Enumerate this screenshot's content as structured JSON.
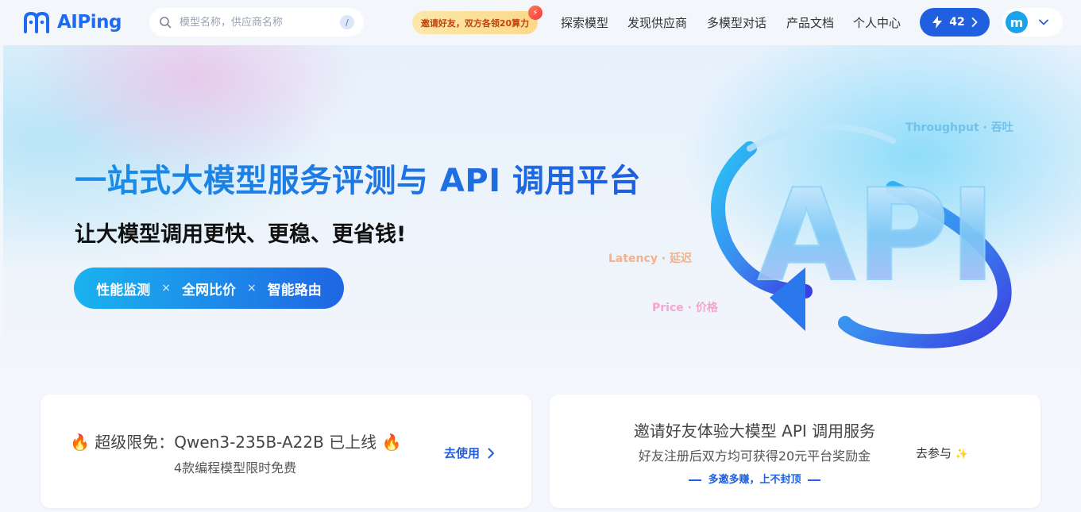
{
  "header": {
    "logo_text": "AIPing",
    "search": {
      "placeholder": "模型名称，供应商名称",
      "shortcut": "/"
    },
    "invite_promo": "邀请好友，双方各领20算力",
    "nav": [
      "探索模型",
      "发现供应商",
      "多模型对话",
      "产品文档",
      "个人中心"
    ],
    "credits": "42",
    "avatar_letter": "m"
  },
  "hero": {
    "title": "一站式大模型服务评测与 API 调用平台",
    "subtitle": "让大模型调用更快、更稳、更省钱!",
    "features": [
      "性能监测",
      "全网比价",
      "智能路由"
    ],
    "feature_separator": "×",
    "art_text": "API",
    "labels": {
      "throughput": "Throughput · 吞吐",
      "latency": "Latency · 延迟",
      "price": "Price · 价格"
    }
  },
  "cards": {
    "promo": {
      "emoji": "🔥",
      "title": "超级限免：Qwen3-235B-A22B 已上线",
      "subtitle": "4款编程模型限时免费",
      "cta": "去使用"
    },
    "invite": {
      "title": "邀请好友体验大模型 API 调用服务",
      "subtitle": "好友注册后双方均可获得20元平台奖励金",
      "note": "多邀多赚，上不封顶",
      "cta": "去参与"
    }
  },
  "colors": {
    "brand": "#1f5fe0",
    "accent": "#1ab3ef",
    "promo_text": "#c2410c"
  }
}
